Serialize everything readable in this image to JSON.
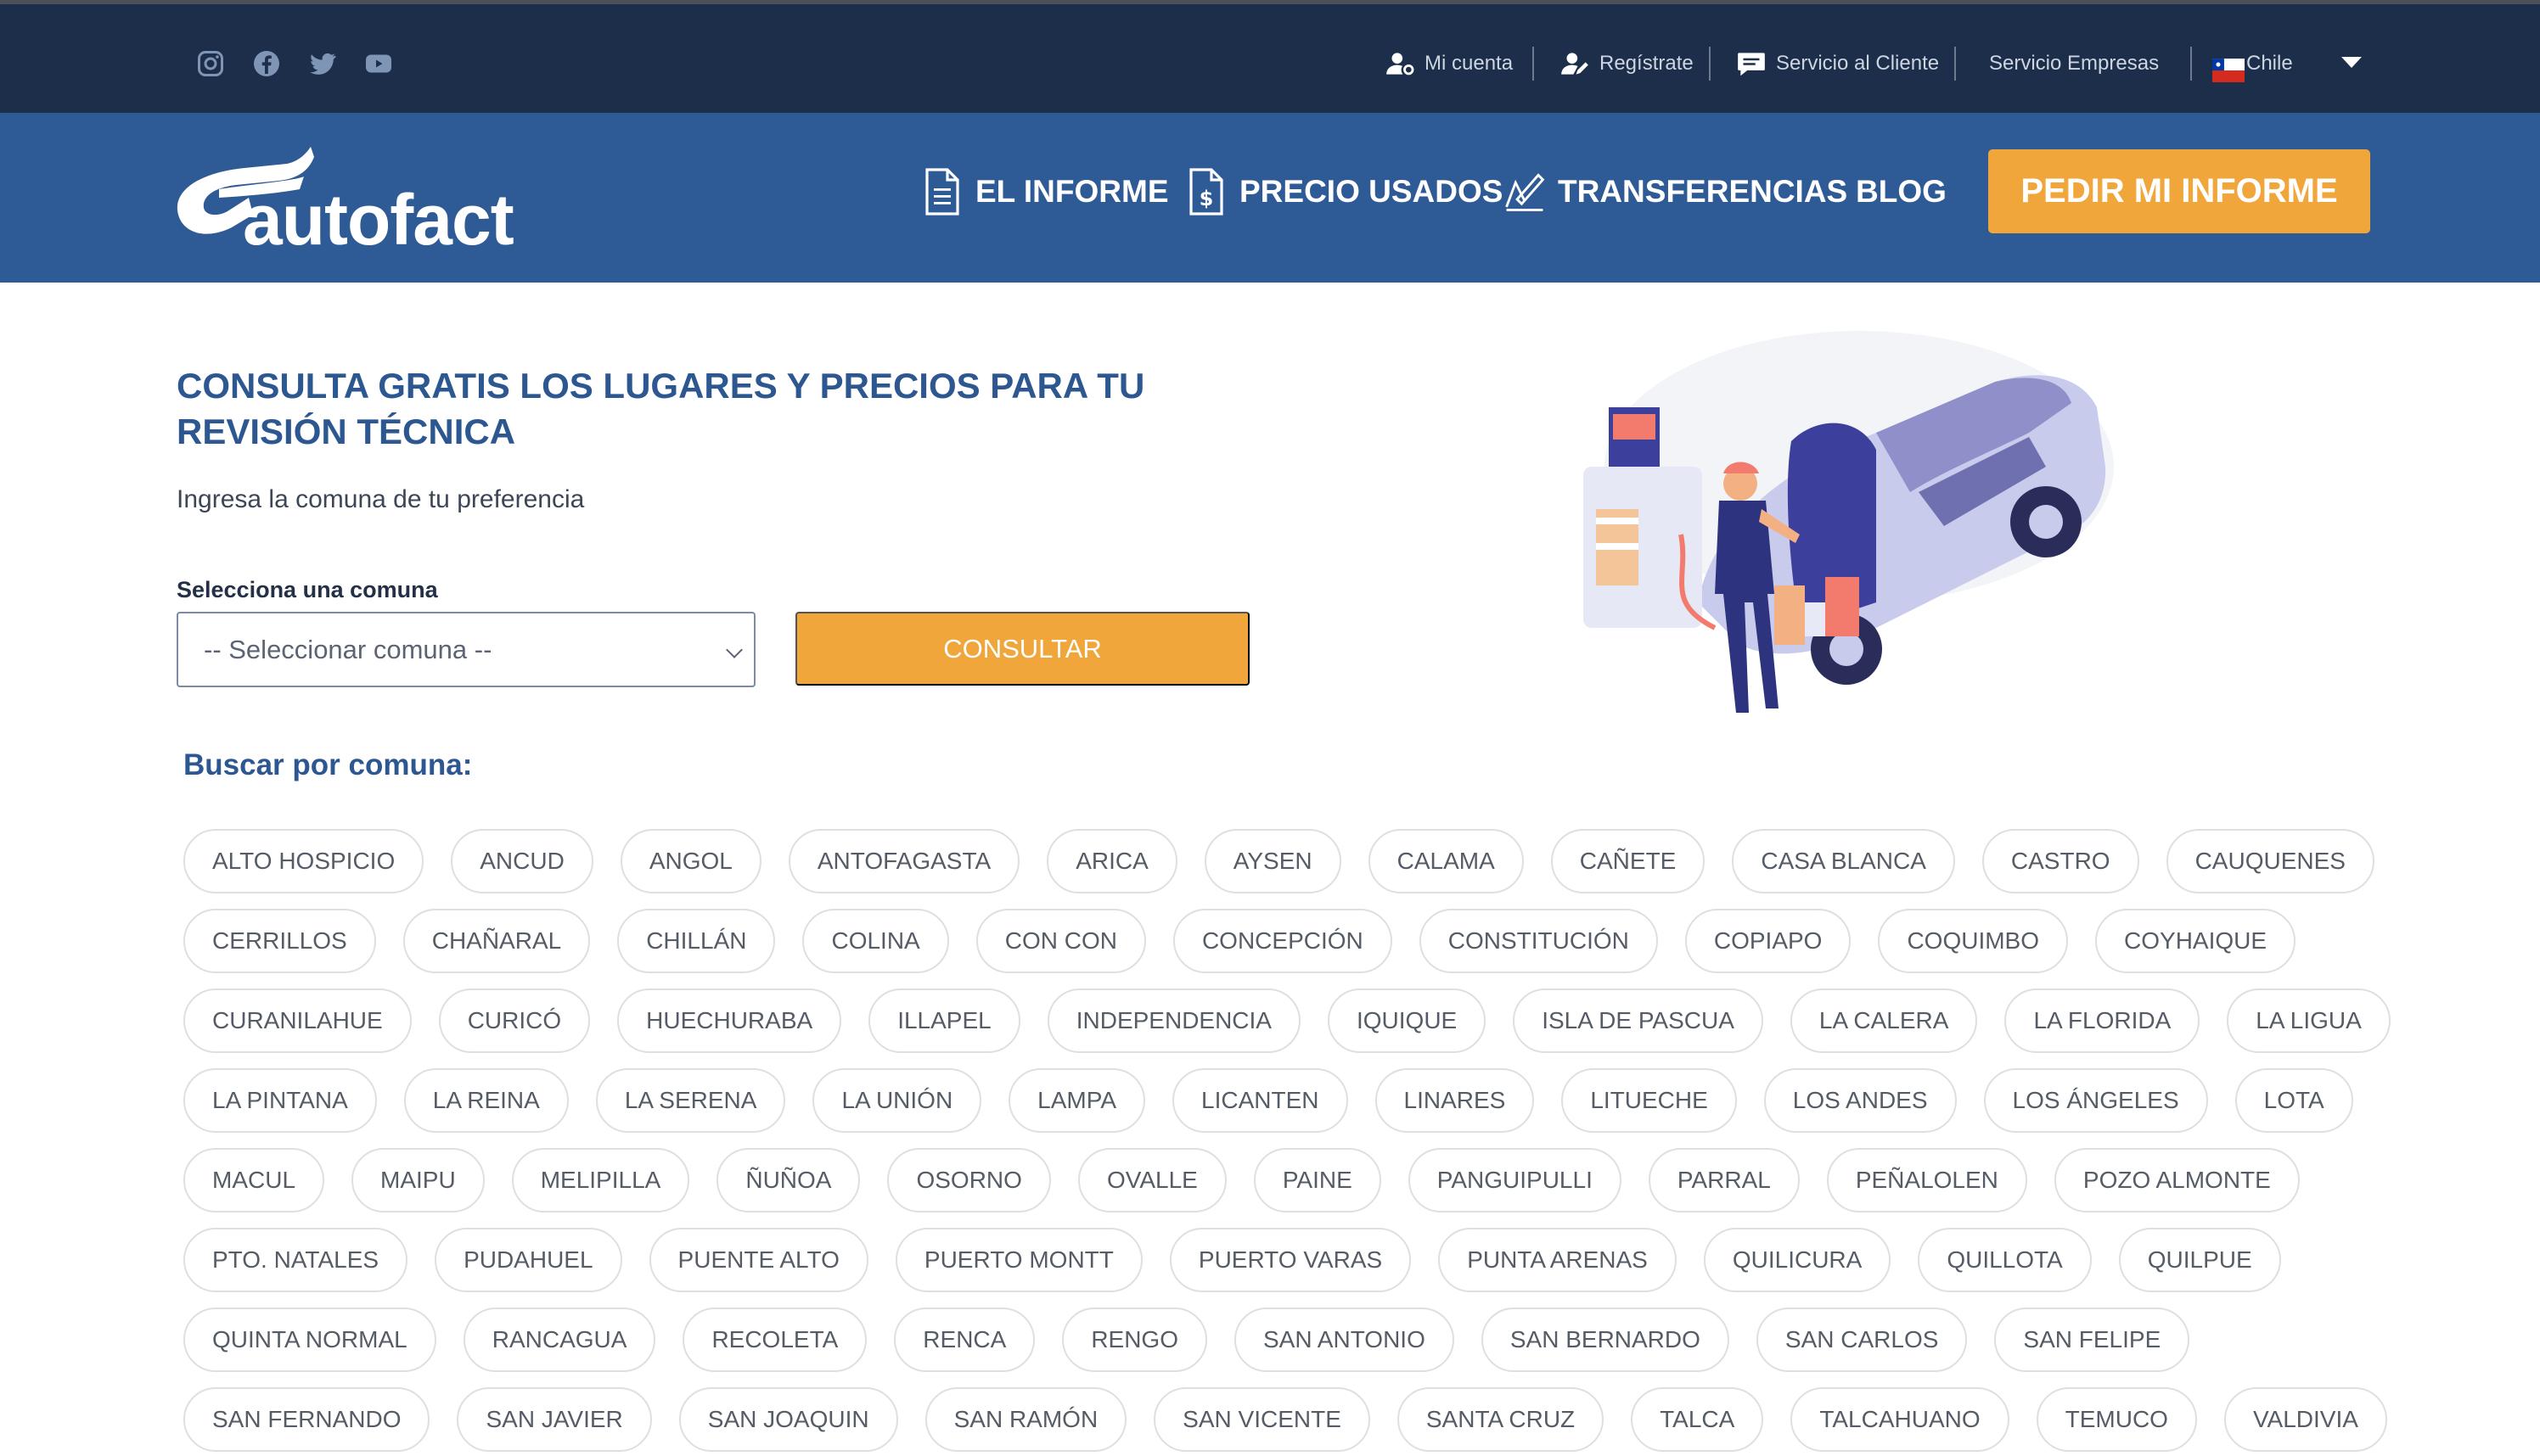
{
  "topbar": {
    "social_icons": [
      "instagram-icon",
      "facebook-icon",
      "twitter-icon",
      "youtube-icon"
    ],
    "mi_cuenta": "Mi cuenta",
    "registrate": "Regístrate",
    "servicio_cliente": "Servicio al Cliente",
    "servicio_empresas": "Servicio Empresas",
    "country": "Chile"
  },
  "brand": {
    "name": "autofact"
  },
  "nav": {
    "items": [
      {
        "label": "EL INFORME",
        "icon": "document-icon"
      },
      {
        "label": "PRECIO USADOS",
        "icon": "price-document-icon"
      },
      {
        "label": "TRANSFERENCIAS",
        "icon": "transfer-pen-icon"
      },
      {
        "label": "BLOG"
      }
    ],
    "cta": "PEDIR MI INFORME"
  },
  "hero": {
    "title": "CONSULTA GRATIS LOS LUGARES Y PRECIOS PARA TU REVISIÓN TÉCNICA",
    "subtitle": "Ingresa la comuna de tu preferencia",
    "select_label": "Selecciona una comuna",
    "select_value": "-- Seleccionar comuna --",
    "button": "CONSULTAR"
  },
  "search": {
    "title": "Buscar por comuna:",
    "rows": [
      [
        "ALTO HOSPICIO",
        "ANCUD",
        "ANGOL",
        "ANTOFAGASTA",
        "ARICA",
        "AYSEN",
        "CALAMA",
        "CAÑETE",
        "CASA BLANCA",
        "CASTRO",
        "CAUQUENES"
      ],
      [
        "CERRILLOS",
        "CHAÑARAL",
        "CHILLÁN",
        "COLINA",
        "CON CON",
        "CONCEPCIÓN",
        "CONSTITUCIÓN",
        "COPIAPO",
        "COQUIMBO",
        "COYHAIQUE"
      ],
      [
        "CURANILAHUE",
        "CURICÓ",
        "HUECHURABA",
        "ILLAPEL",
        "INDEPENDENCIA",
        "IQUIQUE",
        "ISLA DE PASCUA",
        "LA CALERA",
        "LA FLORIDA",
        "LA LIGUA"
      ],
      [
        "LA PINTANA",
        "LA REINA",
        "LA SERENA",
        "LA UNIÓN",
        "LAMPA",
        "LICANTEN",
        "LINARES",
        "LITUECHE",
        "LOS ANDES",
        "LOS ÁNGELES",
        "LOTA"
      ],
      [
        "MACUL",
        "MAIPU",
        "MELIPILLA",
        "ÑUÑOA",
        "OSORNO",
        "OVALLE",
        "PAINE",
        "PANGUIPULLI",
        "PARRAL",
        "PEÑALOLEN",
        "POZO ALMONTE"
      ],
      [
        "PTO. NATALES",
        "PUDAHUEL",
        "PUENTE ALTO",
        "PUERTO MONTT",
        "PUERTO VARAS",
        "PUNTA ARENAS",
        "QUILICURA",
        "QUILLOTA",
        "QUILPUE"
      ],
      [
        "QUINTA NORMAL",
        "RANCAGUA",
        "RECOLETA",
        "RENCA",
        "RENGO",
        "SAN ANTONIO",
        "SAN BERNARDO",
        "SAN CARLOS",
        "SAN FELIPE"
      ],
      [
        "SAN FERNANDO",
        "SAN JAVIER",
        "SAN JOAQUIN",
        "SAN RAMÓN",
        "SAN VICENTE",
        "SANTA CRUZ",
        "TALCA",
        "TALCAHUANO",
        "TEMUCO",
        "VALDIVIA"
      ]
    ]
  },
  "colors": {
    "topbar_bg": "#1c2e4a",
    "nav_bg": "#2e5b96",
    "accent_orange": "#f0a63a",
    "title_blue": "#2d5791"
  }
}
